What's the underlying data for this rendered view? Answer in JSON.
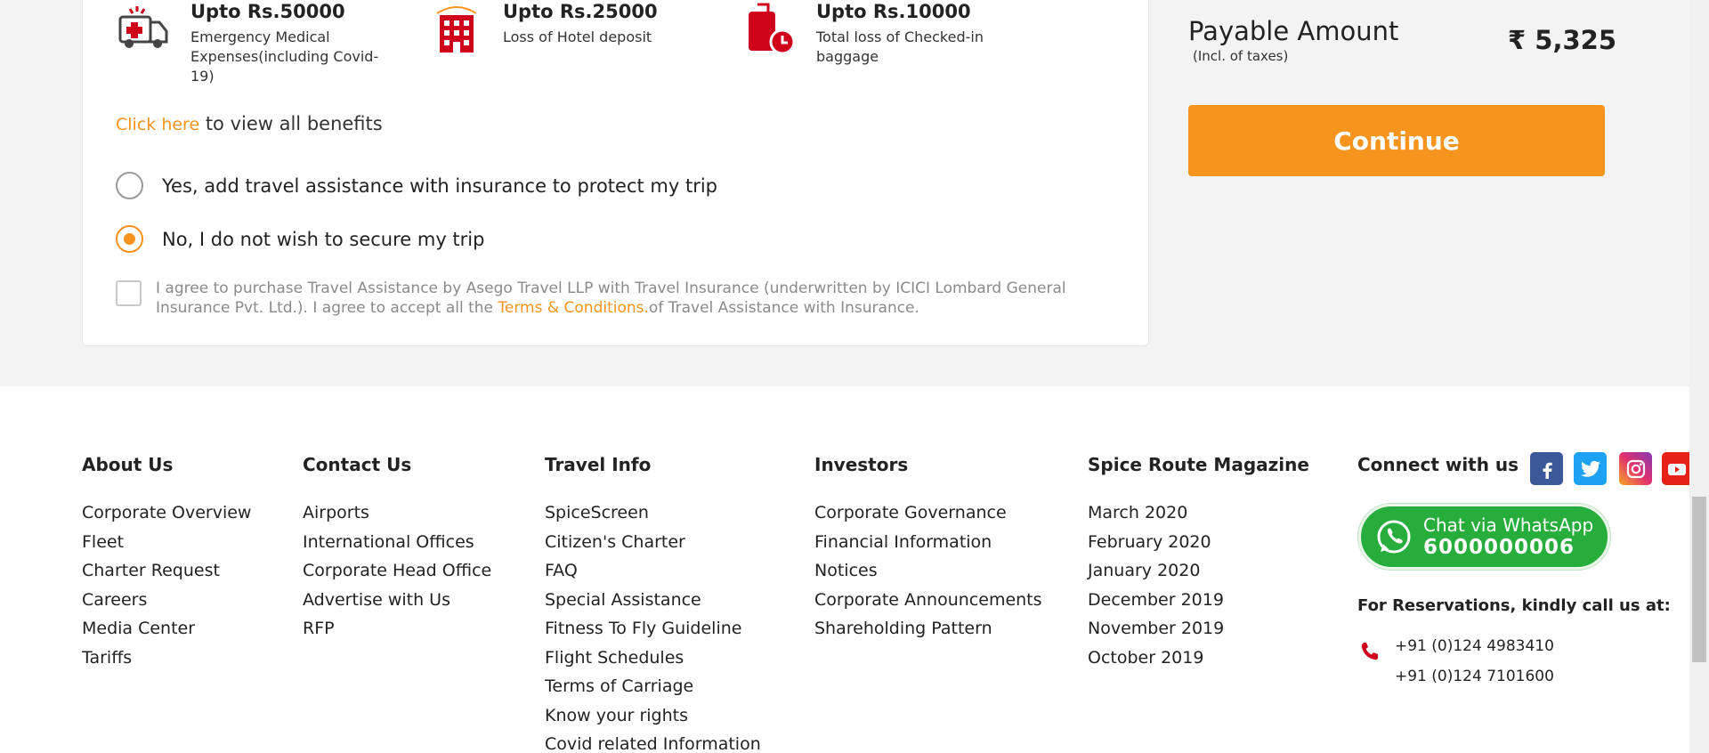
{
  "benefits": [
    {
      "icon": "ambulance-icon",
      "title": "Upto Rs.50000",
      "desc": "Emergency Medical Expenses(including Covid-19)"
    },
    {
      "icon": "hotel-icon",
      "title": "Upto Rs.25000",
      "desc": "Loss of Hotel deposit"
    },
    {
      "icon": "baggage-icon",
      "title": "Upto Rs.10000",
      "desc": "Total loss of Checked-in baggage"
    }
  ],
  "view_benefits": {
    "link": "Click here",
    "text": " to view all benefits"
  },
  "options": {
    "yes_label": "Yes, add travel assistance with insurance to protect my trip",
    "no_label": "No, I do not wish to secure my trip",
    "selected": "no"
  },
  "agreement": {
    "text_before": "I agree to purchase Travel Assistance by Asego Travel LLP with Travel Insurance (underwritten by ICICI Lombard General Insurance Pvt. Ltd.). I agree to accept all the ",
    "link": "Terms & Conditions.",
    "text_after": "of Travel Assistance with Insurance.",
    "checked": false
  },
  "payment": {
    "title": "Payable Amount",
    "subtitle": "(Incl. of taxes)",
    "amount": "₹ 5,325",
    "continue_label": "Continue"
  },
  "footer": {
    "about": {
      "title": "About Us",
      "items": [
        "Corporate Overview",
        "Fleet",
        "Charter Request",
        "Careers",
        "Media Center",
        "Tariffs"
      ]
    },
    "contact": {
      "title": "Contact Us",
      "items": [
        "Airports",
        "International Offices",
        "Corporate Head Office",
        "Advertise with Us",
        "RFP"
      ]
    },
    "travel": {
      "title": "Travel Info",
      "items": [
        "SpiceScreen",
        "Citizen's Charter",
        "FAQ",
        "Special Assistance",
        "Fitness To Fly Guideline",
        "Flight Schedules",
        "Terms of Carriage",
        "Know your rights",
        "Covid related Information"
      ]
    },
    "investors": {
      "title": "Investors",
      "items": [
        "Corporate Governance",
        "Financial Information",
        "Notices",
        "Corporate Announcements",
        "Shareholding Pattern"
      ]
    },
    "magazine": {
      "title": "Spice Route Magazine",
      "items": [
        "March 2020",
        "February 2020",
        "January 2020",
        "December 2019",
        "November 2019",
        "October 2019"
      ]
    },
    "connect": {
      "title": "Connect with us",
      "social": [
        "facebook-icon",
        "twitter-icon",
        "instagram-icon",
        "youtube-icon"
      ],
      "whatsapp_line1": "Chat via WhatsApp",
      "whatsapp_line2": "6000000006",
      "reservations_label": "For Reservations, kindly call us at:",
      "phones": [
        "+91 (0)124 4983410",
        "+91 (0)124 7101600"
      ]
    }
  },
  "colors": {
    "accent": "#f7931e",
    "whatsapp": "#27ad3b",
    "icon_red": "#d0021b"
  }
}
